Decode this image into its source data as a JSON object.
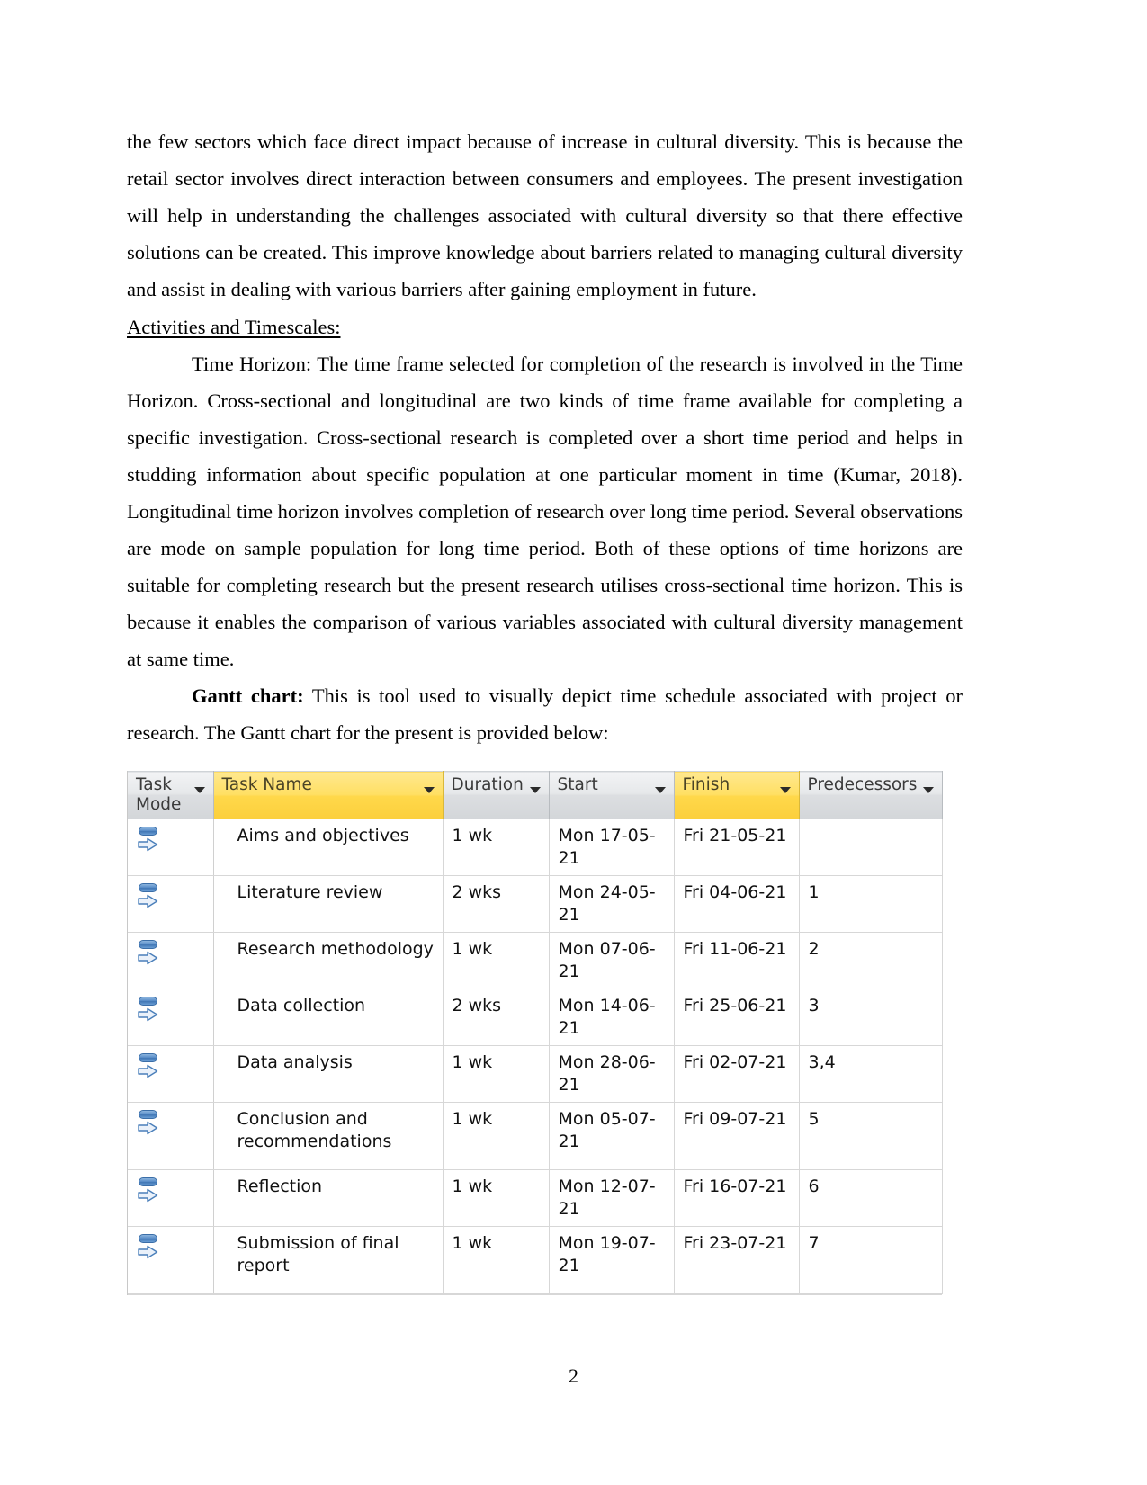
{
  "document": {
    "page_number": "2",
    "paragraphs": [
      {
        "id": "p1",
        "indent": false,
        "text": "the few sectors which face direct impact because of increase in cultural diversity. This is because the retail sector involves direct interaction between consumers and employees. The present investigation will help in understanding the challenges associated with cultural diversity so that there effective solutions can be created. This improve knowledge about barriers related to managing cultural diversity and assist in dealing with various barriers after gaining employment in future."
      },
      {
        "id": "p2",
        "indent": true,
        "text": "Time Horizon: The time frame selected for completion of the research is involved in the Time Horizon. Cross-sectional and longitudinal are two kinds of time frame available for completing a specific investigation. Cross-sectional research is completed over a short time period and helps in studding information about specific population at one particular moment in time (Kumar, 2018). Longitudinal time horizon involves completion of research over long time period.  Several observations are mode on sample population for long time period.  Both of these options of time horizons are suitable for completing research but the present research utilises cross-sectional time horizon. This is because it enables the comparison of various variables associated with cultural diversity management at same time."
      }
    ],
    "section_heading": "Activities and Timescales: ",
    "gantt_intro": {
      "lead_bold": "Gantt chart:",
      "rest": " This is tool used to visually depict time schedule associated with project or research. The Gantt chart for the present is provided below:"
    }
  },
  "gantt_table": {
    "columns": [
      {
        "key": "task_mode",
        "label": "Task Mode",
        "highlight": false
      },
      {
        "key": "task_name",
        "label": "Task Name",
        "highlight": true
      },
      {
        "key": "duration",
        "label": "Duration",
        "highlight": false
      },
      {
        "key": "start",
        "label": "Start",
        "highlight": false
      },
      {
        "key": "finish",
        "label": "Finish",
        "highlight": true
      },
      {
        "key": "predecessors",
        "label": "Predecessors",
        "highlight": false
      }
    ],
    "task_mode_icon": "auto-scheduled-icon",
    "rows": [
      {
        "task_name": "Aims and objectives",
        "duration": "1 wk",
        "start": "Mon 17-05-21",
        "finish": "Fri 21-05-21",
        "predecessors": ""
      },
      {
        "task_name": "Literature review",
        "duration": "2 wks",
        "start": "Mon 24-05-21",
        "finish": "Fri 04-06-21",
        "predecessors": "1"
      },
      {
        "task_name": "Research methodology",
        "duration": "1 wk",
        "start": "Mon 07-06-21",
        "finish": "Fri 11-06-21",
        "predecessors": "2"
      },
      {
        "task_name": "Data collection",
        "duration": "2 wks",
        "start": "Mon 14-06-21",
        "finish": "Fri 25-06-21",
        "predecessors": "3"
      },
      {
        "task_name": "Data analysis",
        "duration": "1 wk",
        "start": "Mon 28-06-21",
        "finish": "Fri 02-07-21",
        "predecessors": "3,4"
      },
      {
        "task_name": "Conclusion and recommendations",
        "duration": "1 wk",
        "start": "Mon 05-07-21",
        "finish": "Fri 09-07-21",
        "predecessors": "5"
      },
      {
        "task_name": "Reflection",
        "duration": "1 wk",
        "start": "Mon 12-07-21",
        "finish": "Fri 16-07-21",
        "predecessors": "6"
      },
      {
        "task_name": "Submission of final report",
        "duration": "1 wk",
        "start": "Mon 19-07-21",
        "finish": "Fri 23-07-21",
        "predecessors": "7"
      }
    ]
  },
  "colors": {
    "header_highlight": "#ffd84a",
    "header_default": "#dcdee1",
    "grid_line": "#d7d7d7",
    "icon_blue": "#4076b4",
    "text": "#000000"
  }
}
